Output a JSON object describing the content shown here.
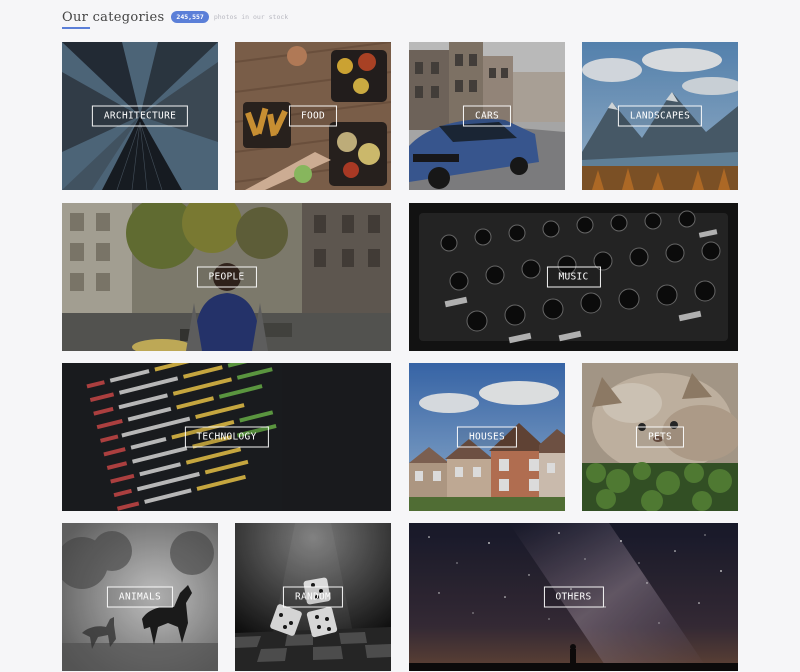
{
  "header": {
    "title": "Our categories",
    "count_badge": "245,557",
    "subtitle": "photos in our stock"
  },
  "categories": [
    {
      "label": "ARCHITECTURE"
    },
    {
      "label": "FOOD"
    },
    {
      "label": "CARS"
    },
    {
      "label": "LANDSCAPES"
    },
    {
      "label": "PEOPLE"
    },
    {
      "label": "MUSIC"
    },
    {
      "label": "TECHNOLOGY"
    },
    {
      "label": "HOUSES"
    },
    {
      "label": "PETS"
    },
    {
      "label": "ANIMALS"
    },
    {
      "label": "RANDOM"
    },
    {
      "label": "OTHERS"
    }
  ],
  "colors": {
    "accent": "#5b7fd8",
    "background": "#f6f6f8"
  }
}
